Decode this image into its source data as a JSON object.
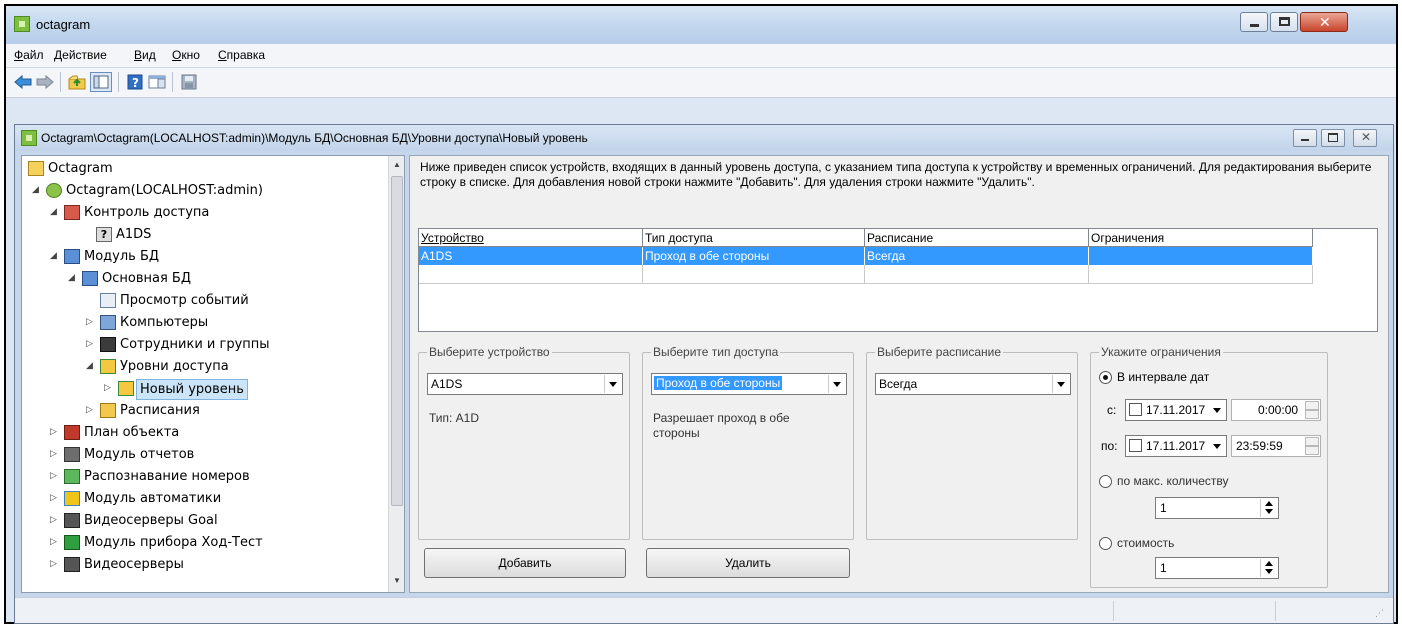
{
  "app": {
    "title": "octagram",
    "menu": [
      {
        "accel": "Ф",
        "rest": "айл"
      },
      {
        "accel": "Д",
        "rest": "ействие"
      },
      {
        "accel": "В",
        "rest": "ид"
      },
      {
        "accel": "О",
        "rest": "кно"
      },
      {
        "accel": "С",
        "rest": "правка"
      }
    ],
    "toolbar_icons": [
      "back-arrow-icon",
      "forward-arrow-icon",
      "folder-up-icon",
      "show-tree-icon",
      "help-icon",
      "panel-icon",
      "save-icon"
    ]
  },
  "child": {
    "title": "Octagram\\Octagram(LOCALHOST:admin)\\Модуль БД\\Основная БД\\Уровни доступа\\Новый уровень"
  },
  "tree": {
    "nodes": [
      {
        "label": "Octagram",
        "icon": "folder-icon"
      },
      {
        "label": "Octagram(LOCALHOST:admin)",
        "icon": "server-icon"
      },
      {
        "label": "Контроль доступа",
        "icon": "lock-icon"
      },
      {
        "label": "A1DS",
        "icon": "question-icon"
      },
      {
        "label": "Модуль БД",
        "icon": "database-module-icon"
      },
      {
        "label": "Основная БД",
        "icon": "database-icon"
      },
      {
        "label": "Просмотр событий",
        "icon": "events-icon"
      },
      {
        "label": "Компьютеры",
        "icon": "computers-icon"
      },
      {
        "label": "Сотрудники и группы",
        "icon": "employees-icon"
      },
      {
        "label": "Уровни доступа",
        "icon": "access-levels-icon"
      },
      {
        "label": "Новый уровень",
        "icon": "access-level-icon"
      },
      {
        "label": "Расписания",
        "icon": "schedule-icon"
      },
      {
        "label": "План объекта",
        "icon": "floor-plan-icon"
      },
      {
        "label": "Модуль отчетов",
        "icon": "reports-icon"
      },
      {
        "label": "Распознавание номеров",
        "icon": "plate-recognition-icon"
      },
      {
        "label": "Модуль автоматики",
        "icon": "automation-icon"
      },
      {
        "label": "Видеосерверы Goal",
        "icon": "video-server-icon"
      },
      {
        "label": "Модуль прибора Ход-Тест",
        "icon": "device-module-icon"
      },
      {
        "label": "Видеосерверы",
        "icon": "video-servers-icon"
      }
    ]
  },
  "panel": {
    "description": "Ниже приведен список устройств, входящих в данный уровень доступа, с указанием типа доступа к устройству и временных ограничений. Для редактирования выберите строку в списке. Для добавления новой строки нажмите \"Добавить\". Для удаления строки нажмите \"Удалить\".",
    "grid": {
      "columns": [
        "Устройство",
        "Тип доступа",
        "Расписание",
        "Ограничения"
      ],
      "rows": [
        [
          "A1DS",
          "Проход в обе стороны",
          "Всегда",
          ""
        ],
        [
          "",
          "",
          "",
          ""
        ]
      ]
    },
    "device_group": {
      "legend": "Выберите устройство",
      "value": "A1DS",
      "info": "Тип: A1D"
    },
    "access_group": {
      "legend": "Выберите тип доступа",
      "value": "Проход в обе стороны",
      "info": "Разрешает проход в обе стороны"
    },
    "schedule_group": {
      "legend": "Выберите расписание",
      "value": "Всегда"
    },
    "limits_group": {
      "legend": "Укажите ограничения",
      "opt_dates": "В интервале дат",
      "from_label": "с:",
      "from_date": "17.11.2017",
      "from_time": "0:00:00",
      "to_label": "по:",
      "to_date": "17.11.2017",
      "to_time": "23:59:59",
      "opt_max": "по макс. количеству",
      "max_value": "1",
      "opt_cost": "стоимость",
      "cost_value": "1"
    },
    "add_label": "Добавить",
    "delete_label": "Удалить"
  }
}
